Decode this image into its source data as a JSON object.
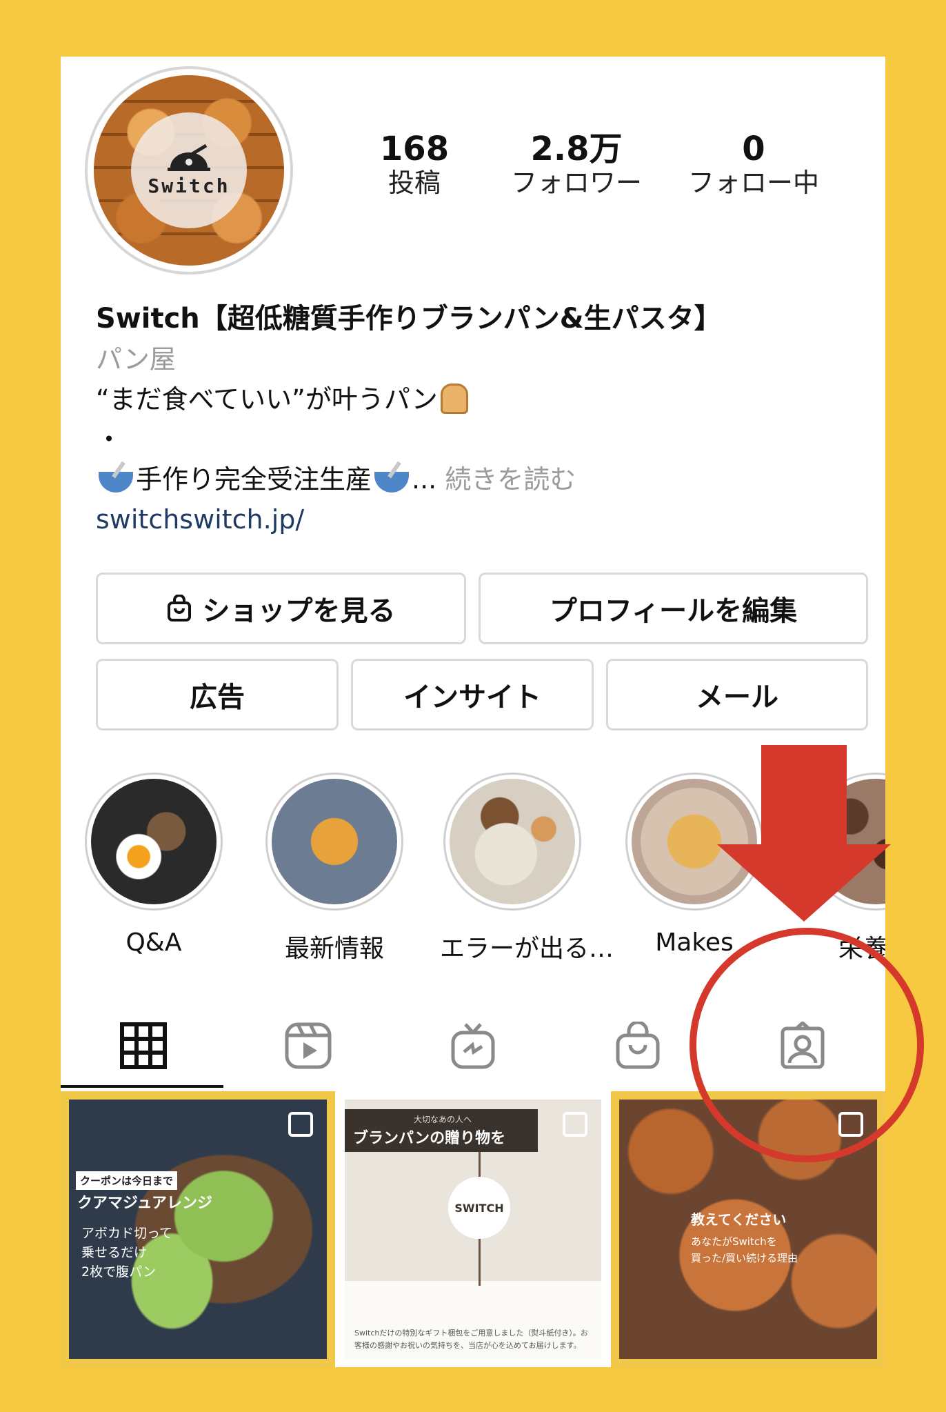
{
  "profile": {
    "avatar_logo_text": "Switch",
    "stats": [
      {
        "value": "168",
        "label": "投稿"
      },
      {
        "value": "2.8万",
        "label": "フォロワー"
      },
      {
        "value": "0",
        "label": "フォロー中"
      }
    ],
    "name": "Switch【超低糖質手作りブランパン&生パスタ】",
    "category": "パン屋",
    "bio_line1": "“まだ食べていい”が叶うパン",
    "bio_line2": "・",
    "bio_line3": "手作り完全受注生産",
    "bio_ellipsis": "...",
    "read_more": "続きを読む",
    "link": "switchswitch.jp/"
  },
  "buttons": {
    "shop": "ショップを見る",
    "edit_profile": "プロフィールを編集",
    "ads": "広告",
    "insights": "インサイト",
    "email": "メール"
  },
  "highlights": [
    {
      "label": "Q&A"
    },
    {
      "label": "最新情報"
    },
    {
      "label": "エラーが出る…"
    },
    {
      "label": "Makes"
    },
    {
      "label": "栄養…"
    }
  ],
  "tabs": [
    "grid-icon",
    "reels-icon",
    "igtv-icon",
    "shop-bag-icon",
    "tagged-icon"
  ],
  "posts": [
    {
      "tag": "クーポンは今日まで",
      "title": "クアマジュアレンジ",
      "text": "アボカド切って\n乗せるだけ\n2枚で腹パン"
    },
    {
      "small": "大切なあの人へ",
      "title": "ブランパンの贈り物を",
      "seal": "SWITCH",
      "footer": "Switchだけの特別なギフト梱包をご用意しました（熨斗紙付き）。お客様の感謝やお祝いの気持ちを、当店が心を込めてお届けします。"
    },
    {
      "title": "教えてください",
      "text": "あなたがSwitchを\n買った/買い続ける理由"
    }
  ],
  "annotation_colors": {
    "arrow": "#d5392c",
    "circle": "#d5392c",
    "background": "#f6c940"
  }
}
